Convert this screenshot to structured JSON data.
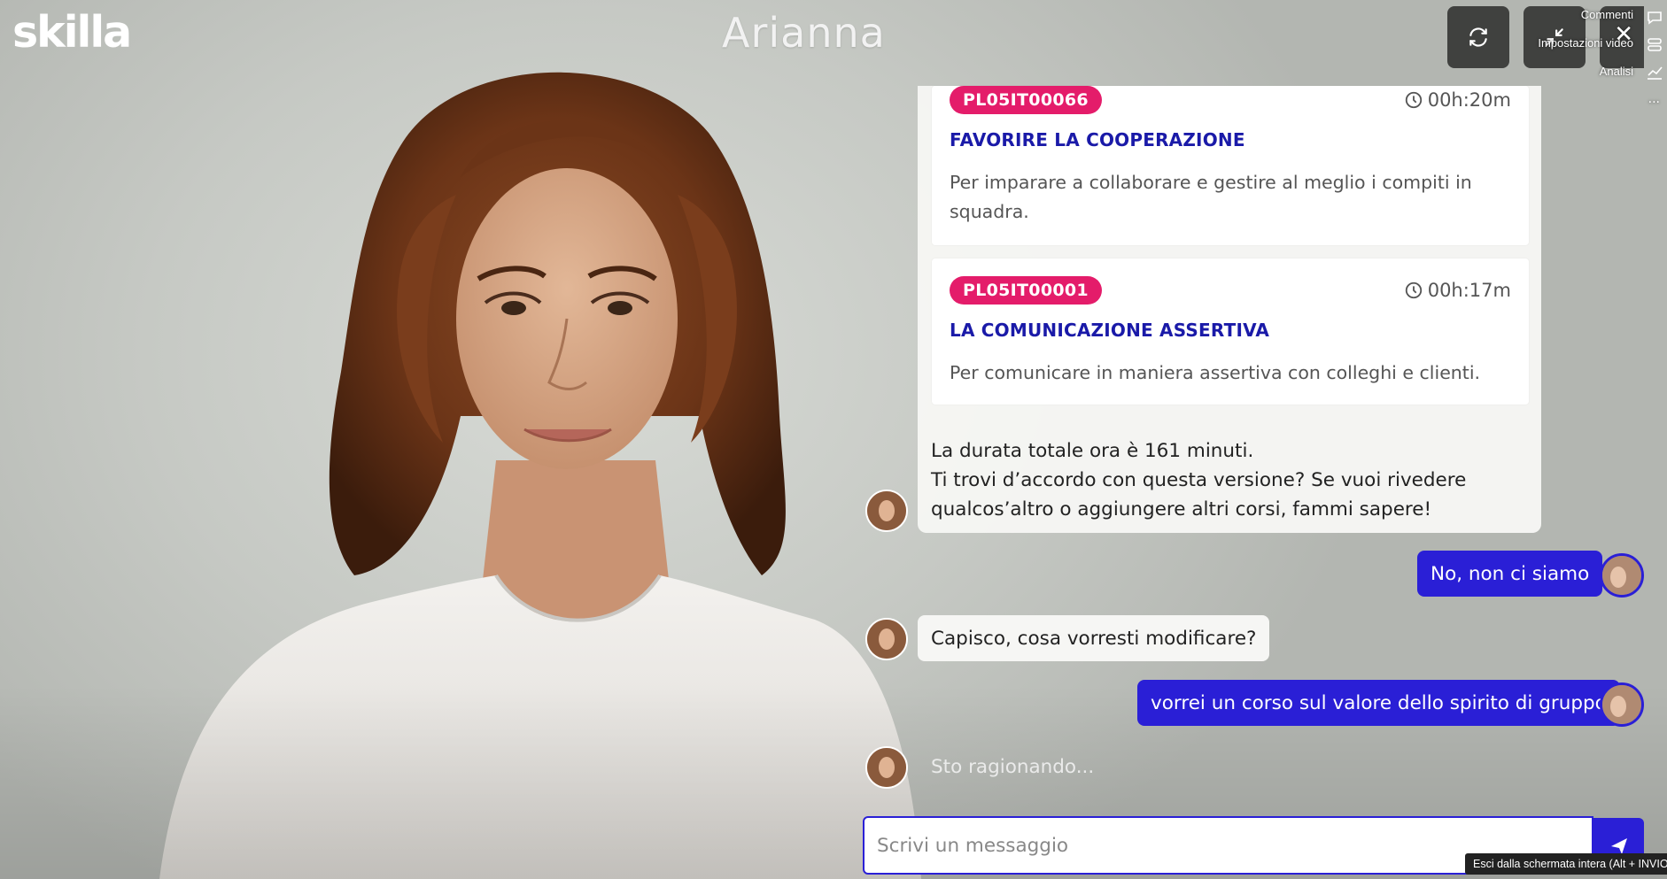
{
  "app": {
    "logo": "skilla",
    "avatar_name": "Arianna"
  },
  "overlay_menu": {
    "comments": "Commenti",
    "video_settings": "Impostazioni video",
    "analysis": "Analisi",
    "more": "..."
  },
  "courses": [
    {
      "code": "PL05IT00066",
      "duration": "00h:20m",
      "title": "FAVORIRE LA COOPERAZIONE",
      "description": "Per imparare a collaborare e gestire al meglio i compiti in squadra."
    },
    {
      "code": "PL05IT00001",
      "duration": "00h:17m",
      "title": "LA COMUNICAZIONE ASSERTIVA",
      "description": "Per comunicare in maniera assertiva con colleghi e clienti."
    }
  ],
  "messages": {
    "bot_summary_line1": "La durata totale ora è 161 minuti.",
    "bot_summary_line2": "Ti trovi d’accordo con questa versione? Se vuoi rivedere qualcos’altro o aggiungere altri corsi, fammi sapere!",
    "user_1": "No, non ci siamo",
    "bot_1": "Capisco, cosa vorresti modificare?",
    "user_2": "vorrei un corso sul valore dello spirito di gruppo",
    "typing": "Sto ragionando..."
  },
  "input": {
    "placeholder": "Scrivi un messaggio",
    "value": ""
  },
  "tooltip": "Esci dalla schermata intera (Alt + INVIO)",
  "colors": {
    "accent": "#2a1fd6",
    "badge": "#e41c6a",
    "title": "#1a1aa8"
  },
  "icons": [
    "refresh-icon",
    "collapse-icon",
    "close-icon",
    "comment-icon",
    "settings-icon",
    "chart-icon",
    "clock-icon",
    "send-icon"
  ]
}
